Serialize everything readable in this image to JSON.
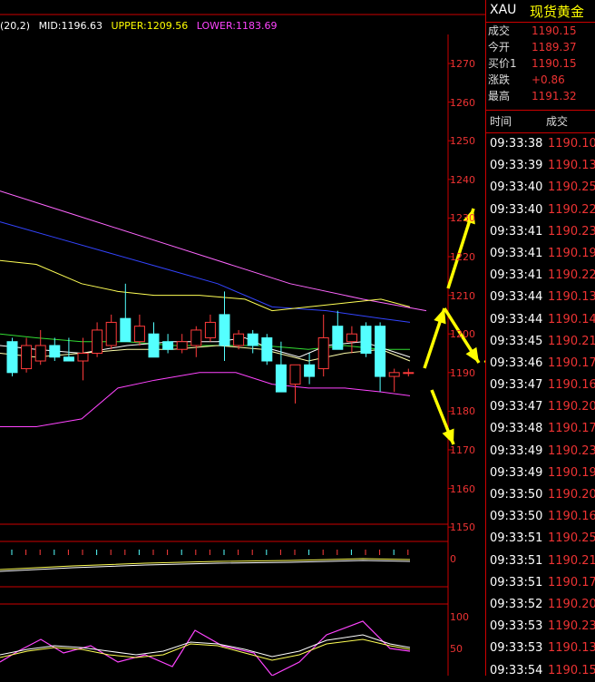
{
  "legend": {
    "params": "(20,2)",
    "mid": "MID:1196.63",
    "upper": "UPPER:1209.56",
    "lower": "LOWER:1183.69"
  },
  "price_axis": [
    "1270",
    "1260",
    "1250",
    "1240",
    "1230",
    "1220",
    "1210",
    "1200",
    "1190",
    "1180",
    "1170",
    "1160",
    "1150"
  ],
  "volume_axis": [
    "0"
  ],
  "indicator_axis": [
    "100",
    "50"
  ],
  "instrument": {
    "code": "XAU",
    "name": "现货黄金"
  },
  "quote": [
    {
      "label": "成交",
      "value": "1190.15"
    },
    {
      "label": "今开",
      "value": "1189.37"
    },
    {
      "label": "买价1",
      "value": "1190.15"
    },
    {
      "label": "涨跌",
      "value": "+0.86"
    },
    {
      "label": "最高",
      "value": "1191.32"
    }
  ],
  "ticks_header": {
    "time": "时间",
    "price": "成交"
  },
  "ticks": [
    {
      "time": "09:33:38",
      "price": "1190.10"
    },
    {
      "time": "09:33:39",
      "price": "1190.13"
    },
    {
      "time": "09:33:40",
      "price": "1190.25"
    },
    {
      "time": "09:33:40",
      "price": "1190.22"
    },
    {
      "time": "09:33:41",
      "price": "1190.23"
    },
    {
      "time": "09:33:41",
      "price": "1190.19"
    },
    {
      "time": "09:33:41",
      "price": "1190.22"
    },
    {
      "time": "09:33:44",
      "price": "1190.13"
    },
    {
      "time": "09:33:44",
      "price": "1190.14"
    },
    {
      "time": "09:33:45",
      "price": "1190.21"
    },
    {
      "time": "09:33:46",
      "price": "1190.17"
    },
    {
      "time": "09:33:47",
      "price": "1190.16"
    },
    {
      "time": "09:33:47",
      "price": "1190.20"
    },
    {
      "time": "09:33:48",
      "price": "1190.17"
    },
    {
      "time": "09:33:49",
      "price": "1190.23"
    },
    {
      "time": "09:33:49",
      "price": "1190.19"
    },
    {
      "time": "09:33:50",
      "price": "1190.20"
    },
    {
      "time": "09:33:50",
      "price": "1190.16"
    },
    {
      "time": "09:33:51",
      "price": "1190.25"
    },
    {
      "time": "09:33:51",
      "price": "1190.21"
    },
    {
      "time": "09:33:51",
      "price": "1190.17"
    },
    {
      "time": "09:33:52",
      "price": "1190.20"
    },
    {
      "time": "09:33:53",
      "price": "1190.23"
    },
    {
      "time": "09:33:53",
      "price": "1190.13"
    },
    {
      "time": "09:33:54",
      "price": "1190.15"
    }
  ],
  "candles": [
    {
      "o": 1198,
      "h": 1199,
      "l": 1189,
      "c": 1190
    },
    {
      "o": 1191,
      "h": 1199,
      "l": 1190,
      "c": 1197
    },
    {
      "o": 1193,
      "h": 1201,
      "l": 1192,
      "c": 1197
    },
    {
      "o": 1197,
      "h": 1199,
      "l": 1193,
      "c": 1194
    },
    {
      "o": 1194,
      "h": 1199,
      "l": 1193,
      "c": 1193
    },
    {
      "o": 1193,
      "h": 1199,
      "l": 1188,
      "c": 1195
    },
    {
      "o": 1195,
      "h": 1203,
      "l": 1194,
      "c": 1201
    },
    {
      "o": 1197,
      "h": 1205,
      "l": 1196,
      "c": 1203
    },
    {
      "o": 1204,
      "h": 1213,
      "l": 1198,
      "c": 1198
    },
    {
      "o": 1198,
      "h": 1205,
      "l": 1197,
      "c": 1202
    },
    {
      "o": 1200,
      "h": 1203,
      "l": 1195,
      "c": 1194
    },
    {
      "o": 1198,
      "h": 1200,
      "l": 1195,
      "c": 1196
    },
    {
      "o": 1196,
      "h": 1200,
      "l": 1195,
      "c": 1198
    },
    {
      "o": 1197,
      "h": 1202,
      "l": 1194,
      "c": 1201
    },
    {
      "o": 1199,
      "h": 1205,
      "l": 1198,
      "c": 1203
    },
    {
      "o": 1205,
      "h": 1211,
      "l": 1193,
      "c": 1197
    },
    {
      "o": 1197,
      "h": 1201,
      "l": 1196,
      "c": 1200
    },
    {
      "o": 1200,
      "h": 1201,
      "l": 1195,
      "c": 1197
    },
    {
      "o": 1199,
      "h": 1200,
      "l": 1192,
      "c": 1193
    },
    {
      "o": 1192,
      "h": 1198,
      "l": 1185,
      "c": 1185
    },
    {
      "o": 1187,
      "h": 1192,
      "l": 1182,
      "c": 1192
    },
    {
      "o": 1192,
      "h": 1195,
      "l": 1187,
      "c": 1189
    },
    {
      "o": 1191,
      "h": 1205,
      "l": 1189,
      "c": 1199
    },
    {
      "o": 1202,
      "h": 1206,
      "l": 1196,
      "c": 1196
    },
    {
      "o": 1198,
      "h": 1202,
      "l": 1195,
      "c": 1200
    },
    {
      "o": 1202,
      "h": 1203,
      "l": 1194,
      "c": 1195
    },
    {
      "o": 1202,
      "h": 1203,
      "l": 1185,
      "c": 1189
    },
    {
      "o": 1189,
      "h": 1191,
      "l": 1185,
      "c": 1190
    },
    {
      "o": 1190,
      "h": 1191,
      "l": 1189,
      "c": 1190
    }
  ],
  "colors": {
    "bg": "#000000",
    "grid_red": "#cc0000",
    "up_candle": "#ff3b3b",
    "down_candle": "#54ffff",
    "upper_band": "#ffff55",
    "mid_band": "#ffffff",
    "lower_band": "#ff44ff",
    "ma_blue": "#3344ff",
    "ma_pink": "#ff66ff",
    "ma_green": "#33dd33",
    "arrow": "#ffff00",
    "price_text": "#ee3333"
  },
  "icons": [
    "up-arrow-icon",
    "down-arrow-icon"
  ]
}
